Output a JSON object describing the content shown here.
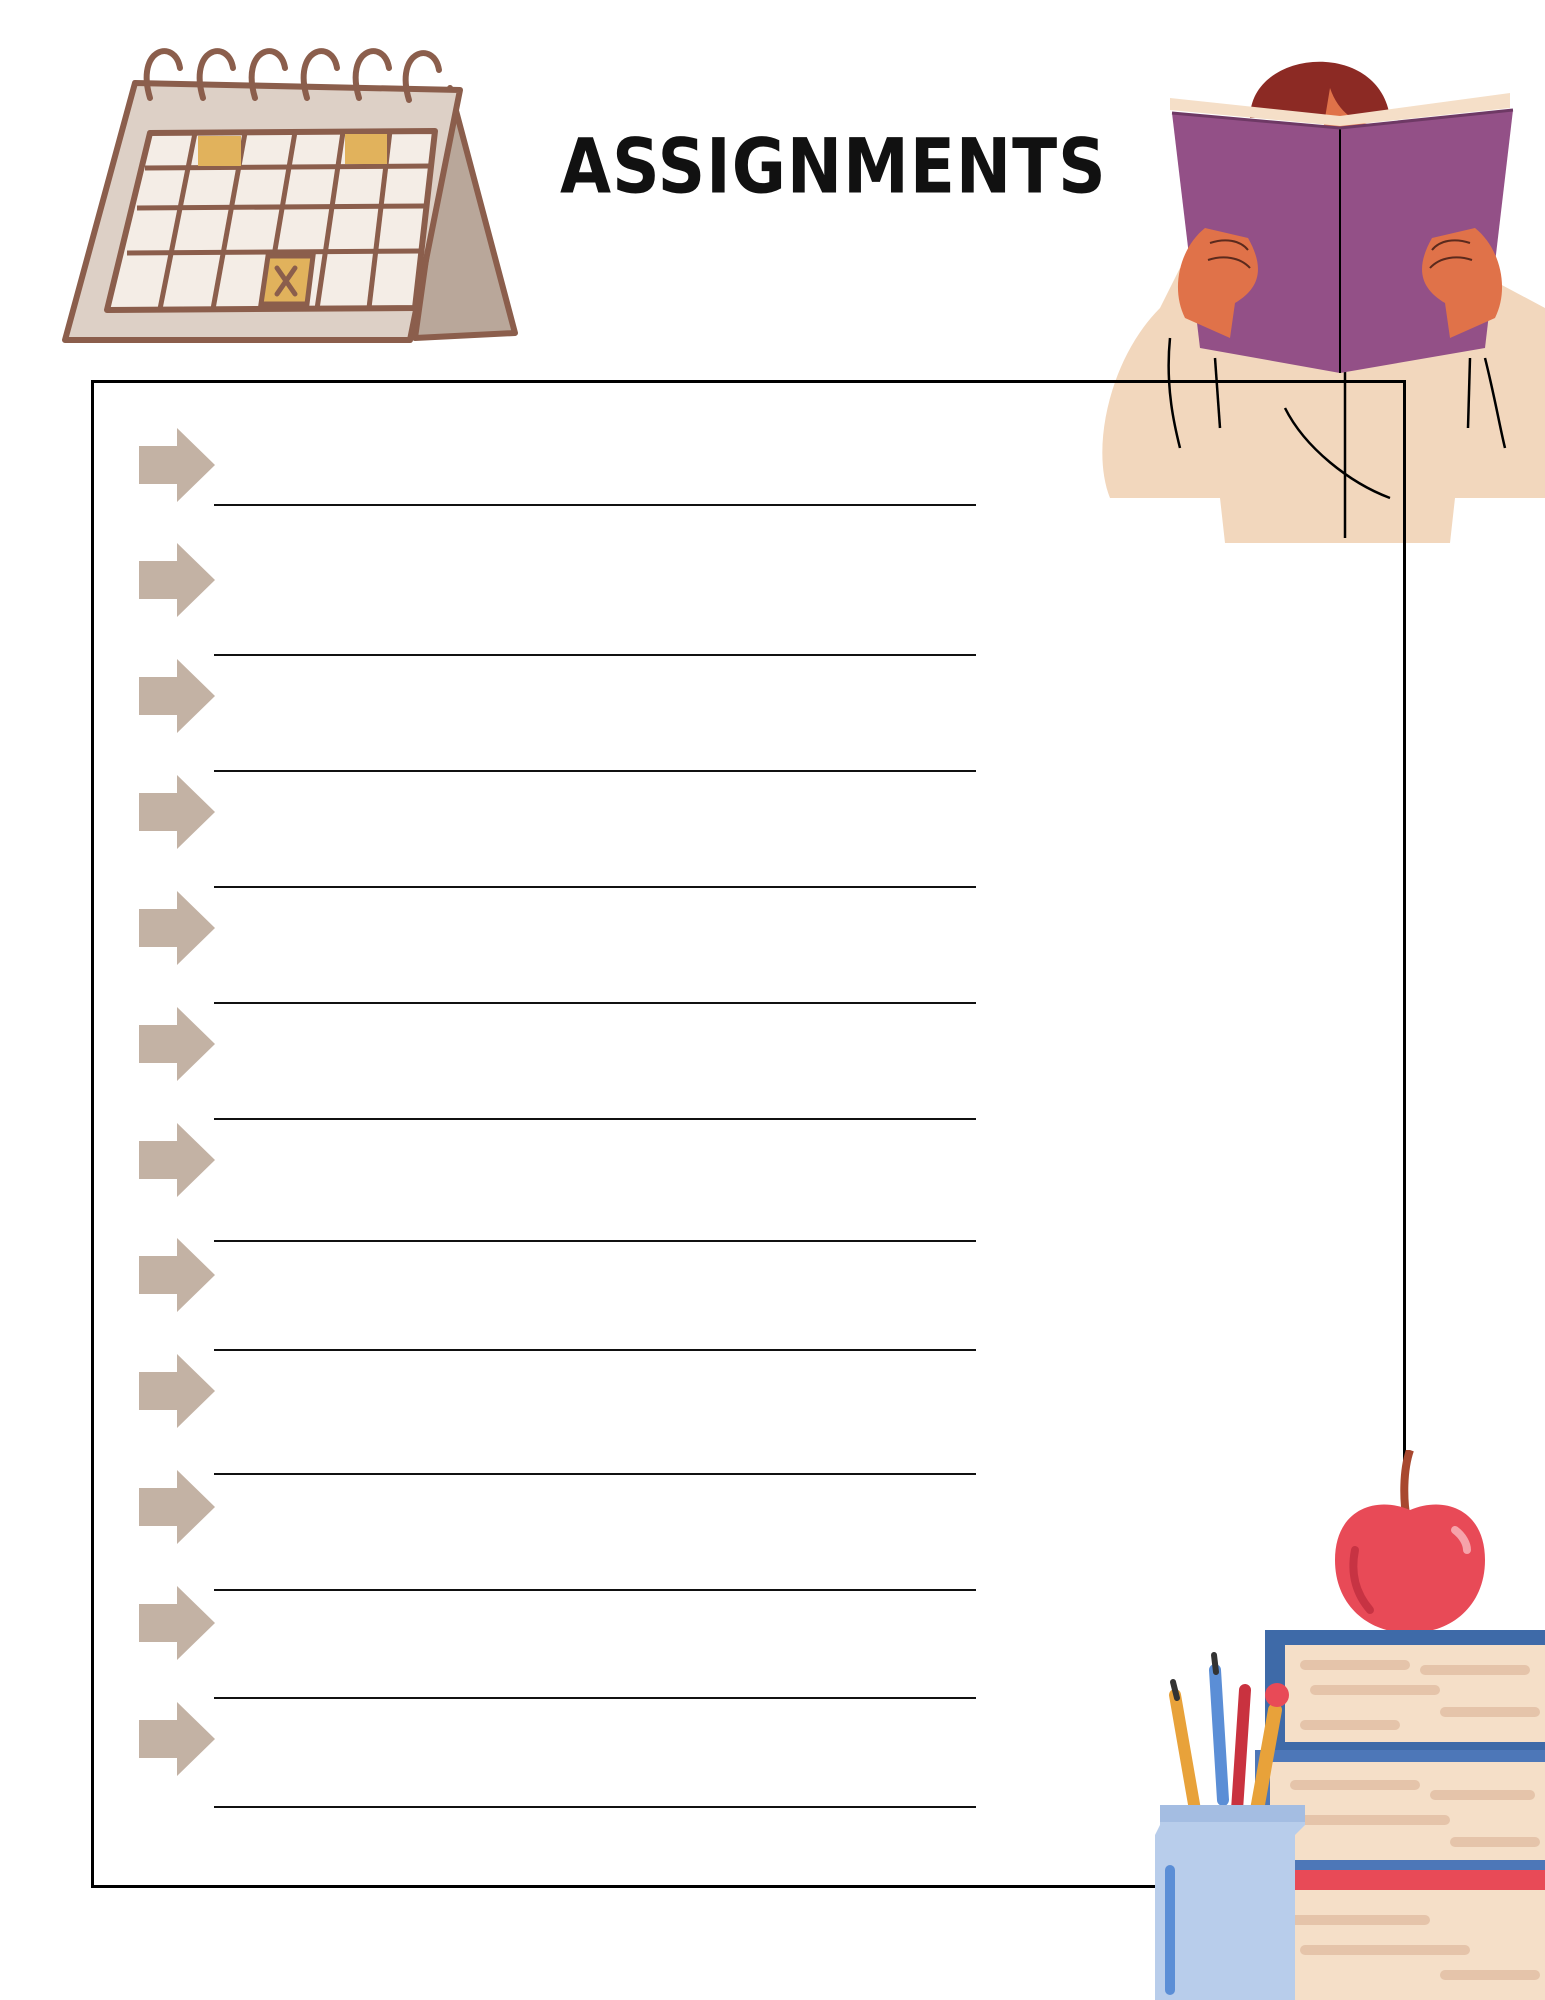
{
  "page": {
    "title": "ASSIGNMENTS"
  },
  "colors": {
    "arrow": "#c3b2a4",
    "frame": "#000000",
    "calendar_body": "#ddd0c6",
    "calendar_outline": "#8b5e4c",
    "calendar_highlight": "#e1b25c",
    "book_cover": "#935087",
    "skin": "#e07249",
    "hair": "#8c2a24",
    "shirt": "#f2d7bd",
    "apple": "#e84a57",
    "book_blue": "#3e6aa8",
    "book_pages": "#f5dfc8",
    "jar": "#b8cdeb"
  },
  "illustrations": [
    "calendar-icon",
    "person-reading-book-icon",
    "apple-books-pencil-jar-icon"
  ],
  "assignment_rows": [
    {
      "id": 1
    },
    {
      "id": 2
    },
    {
      "id": 3
    },
    {
      "id": 4
    },
    {
      "id": 5
    },
    {
      "id": 6
    },
    {
      "id": 7
    },
    {
      "id": 8
    },
    {
      "id": 9
    },
    {
      "id": 10
    },
    {
      "id": 11
    },
    {
      "id": 12
    }
  ]
}
